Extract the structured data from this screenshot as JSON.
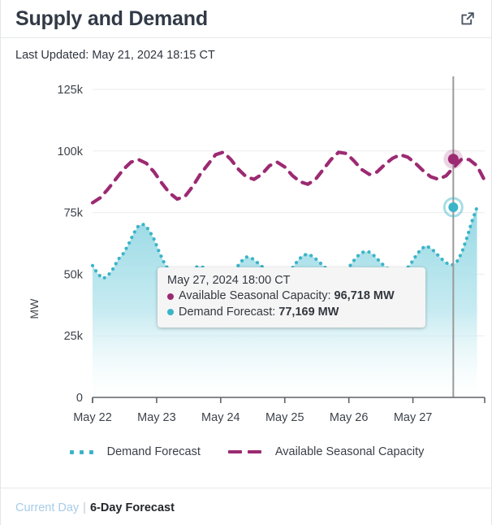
{
  "header": {
    "title": "Supply and Demand",
    "external_link_icon": "external-link-icon"
  },
  "last_updated": "Last Updated: May 21, 2024 18:15 CT",
  "tooltip": {
    "date": "May 27, 2024 18:00 CT",
    "rows": [
      {
        "label": "Available Seasonal Capacity:",
        "value": "96,718 MW",
        "color": "#9c2a72"
      },
      {
        "label": "Demand Forecast:",
        "value": "77,169 MW",
        "color": "#3cb4c8"
      }
    ]
  },
  "legend": [
    {
      "label": "Demand Forecast",
      "style": "dotted",
      "color": "#3cb4c8"
    },
    {
      "label": "Available Seasonal Capacity",
      "style": "dashed",
      "color": "#9c2a72"
    }
  ],
  "footer": {
    "current_day": "Current Day",
    "separator": "|",
    "six_day_forecast": "6-Day Forecast"
  },
  "colors": {
    "demand": "#3cb4c8",
    "capacity": "#9c2a72",
    "grid": "#e9ebed",
    "axis": "#6b7076",
    "crosshair": "#9a9a9a",
    "link": "#a7cbe8"
  },
  "chart_data": {
    "type": "line",
    "title": "Supply and Demand",
    "xlabel": "",
    "ylabel": "MW",
    "ylim": [
      0,
      125000
    ],
    "yticks": [
      "0",
      "25k",
      "50k",
      "75k",
      "100k",
      "125k"
    ],
    "ytick_values": [
      0,
      25000,
      50000,
      75000,
      100000,
      125000
    ],
    "xticks": [
      "May 22",
      "May 23",
      "May 24",
      "May 25",
      "May 26",
      "May 27"
    ],
    "grid": true,
    "legend_position": "bottom",
    "hover": {
      "x_label": "May 27, 2024 18:00 CT",
      "capacity_value": 96718,
      "demand_value": 77169
    },
    "series": [
      {
        "name": "Demand Forecast",
        "style": "dotted",
        "color": "#3cb4c8",
        "fill": true,
        "x": [
          0,
          0.08,
          0.16,
          0.24,
          0.32,
          0.4,
          0.48,
          0.56,
          0.64,
          0.72,
          0.8,
          0.88,
          0.96,
          1.04,
          1.12,
          1.2,
          1.28,
          1.36,
          1.44,
          1.52,
          1.6,
          1.68,
          1.76,
          1.84,
          1.92,
          2.0,
          2.08,
          2.16,
          2.24,
          2.32,
          2.4,
          2.48,
          2.56,
          2.64,
          2.72,
          2.8,
          2.88,
          2.96,
          3.04,
          3.12,
          3.2,
          3.28,
          3.36,
          3.44,
          3.52,
          3.6,
          3.68,
          3.76,
          3.84,
          3.92,
          4.0,
          4.08,
          4.16,
          4.24,
          4.32,
          4.4,
          4.48,
          4.56,
          4.64,
          4.72,
          4.8,
          4.88,
          4.96,
          5.04,
          5.12,
          5.2,
          5.28,
          5.36,
          5.44,
          5.52,
          5.6,
          5.68,
          5.76,
          5.84,
          5.92,
          6.0
        ],
        "values": [
          53500,
          50200,
          48200,
          49400,
          52200,
          56000,
          58400,
          62000,
          66500,
          69800,
          70200,
          68000,
          64200,
          59000,
          54500,
          51200,
          48600,
          46800,
          48600,
          51500,
          52800,
          53200,
          52400,
          51200,
          50000,
          49200,
          48600,
          49600,
          52400,
          55200,
          57000,
          56600,
          55000,
          53200,
          51400,
          50200,
          49400,
          49000,
          50200,
          52600,
          55400,
          57600,
          58200,
          57200,
          55400,
          53400,
          51600,
          50400,
          49800,
          50600,
          52800,
          55600,
          58000,
          59200,
          59000,
          57400,
          55200,
          53200,
          51600,
          50600,
          50200,
          51400,
          54000,
          57200,
          60000,
          61500,
          60600,
          58600,
          56400,
          54600,
          53600,
          54800,
          58600,
          64600,
          71400,
          77169
        ]
      },
      {
        "name": "Available Seasonal Capacity",
        "style": "dashed",
        "color": "#9c2a72",
        "fill": false,
        "x": [
          0,
          0.12,
          0.24,
          0.36,
          0.48,
          0.6,
          0.72,
          0.84,
          0.96,
          1.08,
          1.2,
          1.32,
          1.44,
          1.56,
          1.68,
          1.8,
          1.92,
          2.04,
          2.16,
          2.28,
          2.4,
          2.52,
          2.64,
          2.76,
          2.88,
          3.0,
          3.12,
          3.24,
          3.36,
          3.48,
          3.6,
          3.72,
          3.84,
          3.96,
          4.08,
          4.2,
          4.32,
          4.44,
          4.56,
          4.68,
          4.8,
          4.92,
          5.04,
          5.16,
          5.28,
          5.4,
          5.52,
          5.64,
          5.76,
          5.88,
          6.0,
          6.12
        ],
        "values": [
          79000,
          81000,
          84500,
          88500,
          92500,
          95500,
          96500,
          95000,
          91500,
          87000,
          83000,
          80500,
          81500,
          85500,
          90500,
          94500,
          98500,
          99500,
          96500,
          92500,
          89500,
          88500,
          90500,
          94000,
          95500,
          93500,
          90000,
          87500,
          86500,
          88500,
          92500,
          96500,
          99500,
          99000,
          96000,
          92500,
          90500,
          91500,
          94500,
          97000,
          98500,
          97500,
          95000,
          92000,
          89500,
          88500,
          90000,
          93500,
          96718,
          96500,
          94000,
          88000
        ]
      }
    ]
  }
}
